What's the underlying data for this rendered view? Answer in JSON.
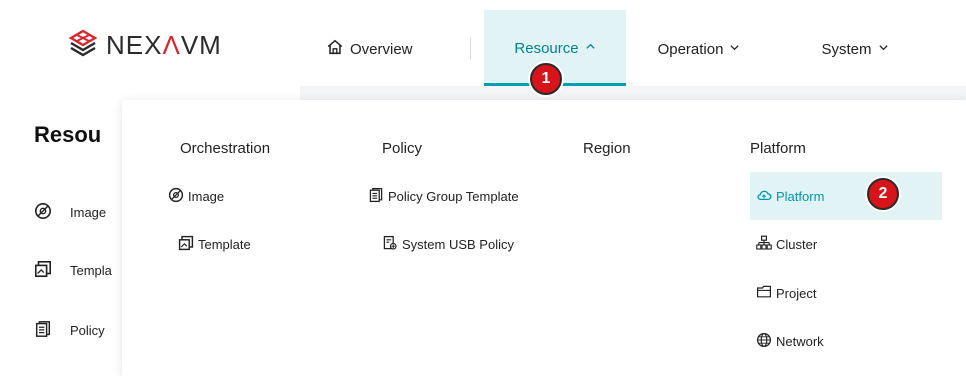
{
  "brand": {
    "logo_text_pre": "NEX",
    "logo_text_lambda": "Λ",
    "logo_text_post": "VM",
    "logo_icon": "nexavm-logo-icon",
    "accent": "#d9262c"
  },
  "nav": {
    "overview": {
      "label": "Overview",
      "icon": "home-icon"
    },
    "resource": {
      "label": "Resource",
      "expanded": true,
      "accent": "#00838f",
      "bg": "#e2f3f6"
    },
    "operation": {
      "label": "Operation"
    },
    "system": {
      "label": "System"
    }
  },
  "badges": {
    "one": "1",
    "two": "2",
    "color": "#d7141a"
  },
  "left_panel": {
    "title": "Resou",
    "items": [
      {
        "label": "Image",
        "icon": "image-disc-icon"
      },
      {
        "label": "Templa",
        "icon": "template-icon"
      },
      {
        "label": "Policy",
        "icon": "policy-doc-icon"
      }
    ]
  },
  "dropdown": {
    "columns": [
      {
        "heading": "Orchestration",
        "links": [
          {
            "label": "Image",
            "icon": "image-disc-icon"
          },
          {
            "label": "Template",
            "icon": "template-icon"
          }
        ]
      },
      {
        "heading": "Policy",
        "links": [
          {
            "label": "Policy Group Template",
            "icon": "policy-doc-icon"
          },
          {
            "label": "System USB Policy",
            "icon": "usb-policy-icon"
          }
        ]
      },
      {
        "heading": "Region",
        "links": []
      },
      {
        "heading": "Platform",
        "links": [
          {
            "label": "Platform",
            "icon": "cloud-icon",
            "active": true
          },
          {
            "label": "Cluster",
            "icon": "cluster-icon"
          },
          {
            "label": "Project",
            "icon": "folder-icon"
          },
          {
            "label": "Network",
            "icon": "globe-icon"
          }
        ]
      }
    ]
  }
}
